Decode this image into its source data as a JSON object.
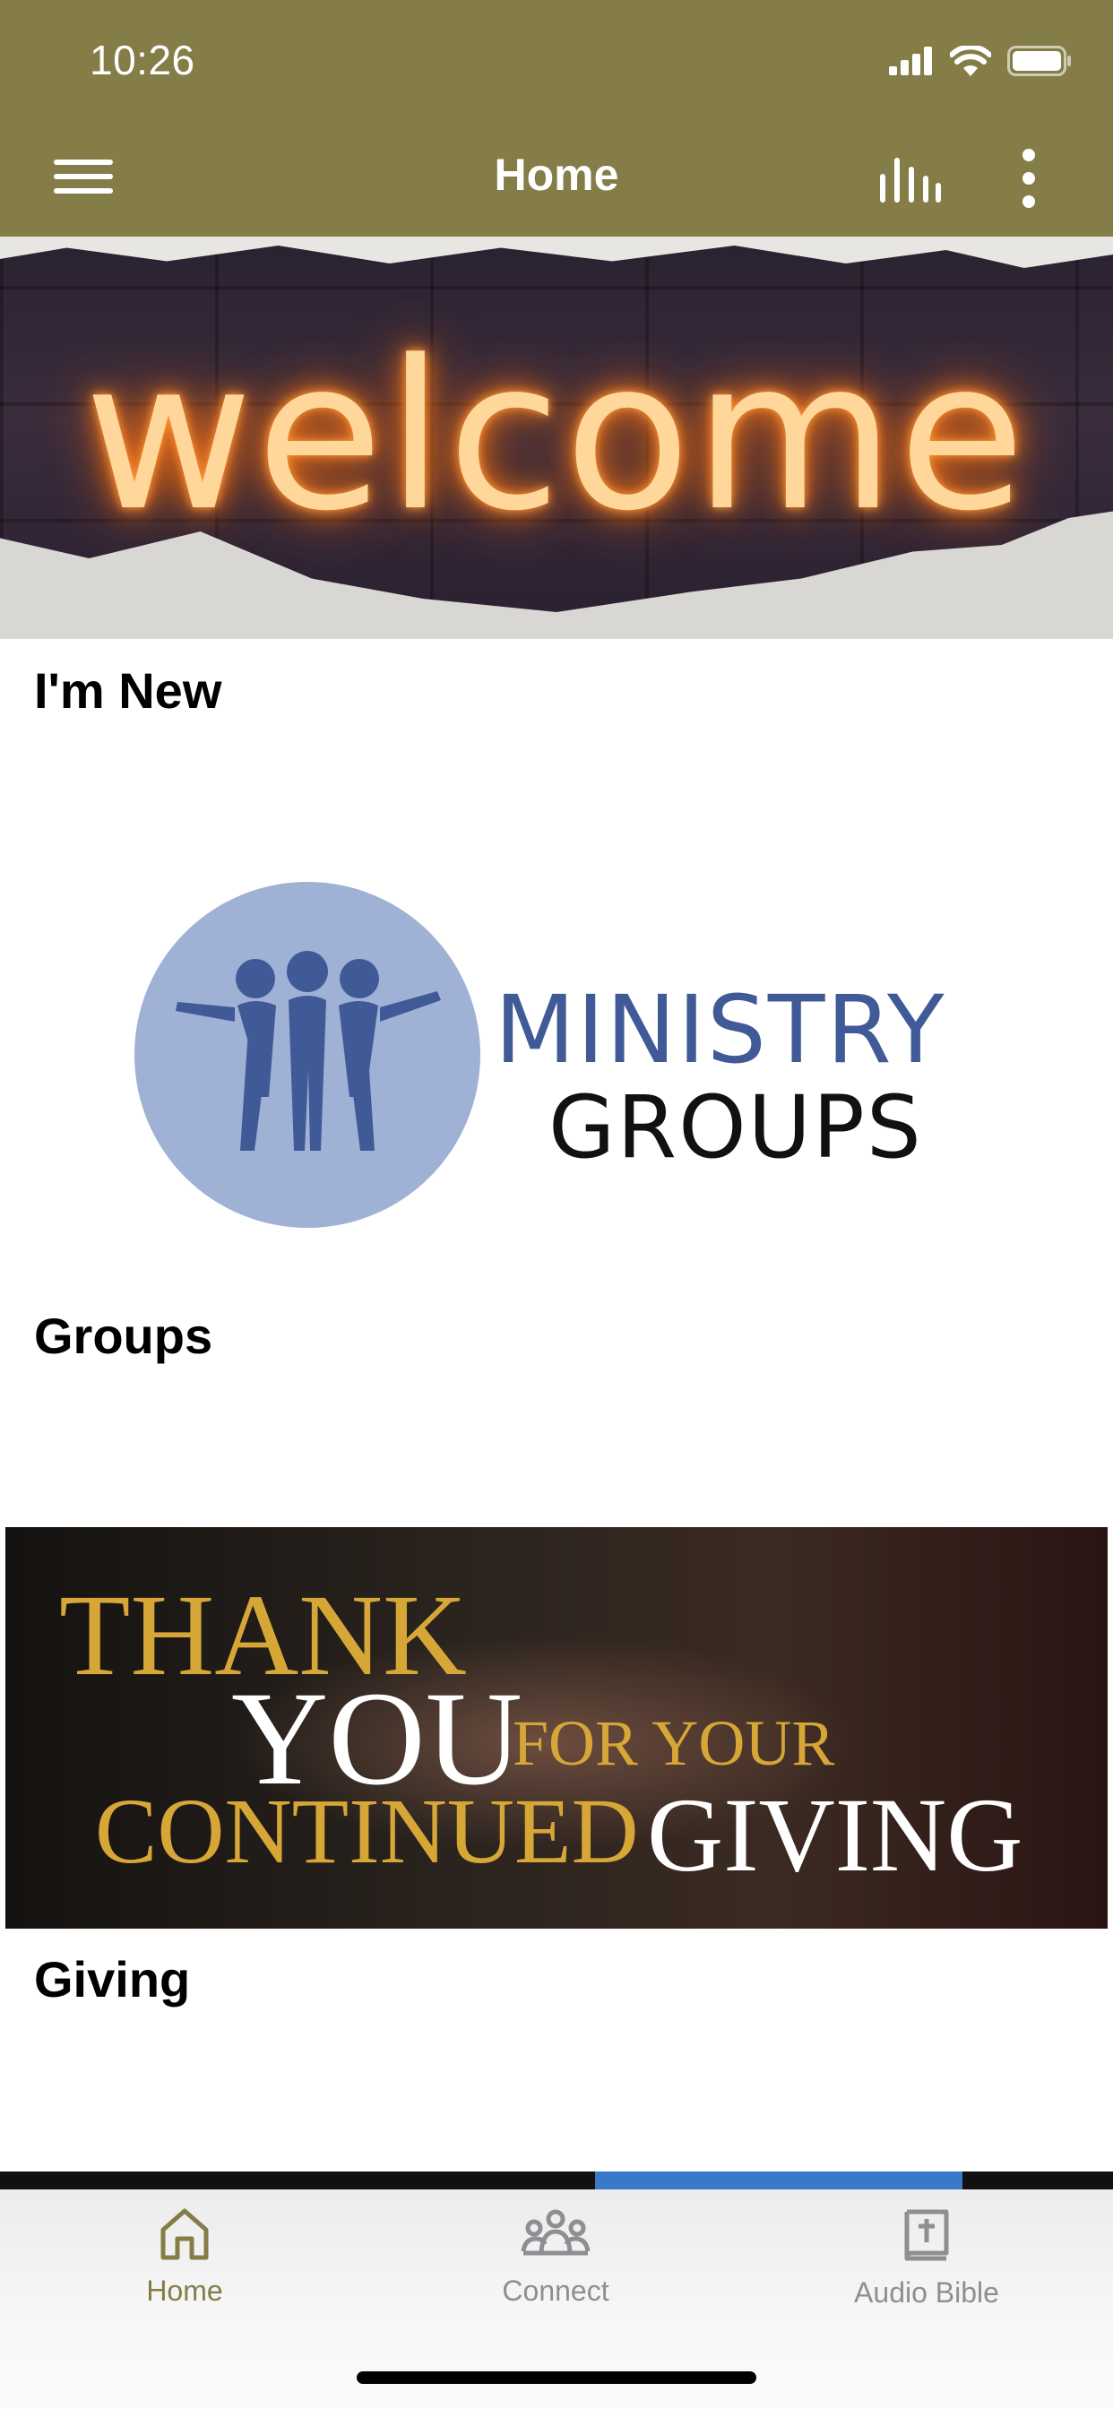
{
  "status_bar": {
    "time": "10:26"
  },
  "header": {
    "title": "Home"
  },
  "colors": {
    "accent": "#857d47",
    "tab_inactive": "#8e8e93",
    "background": "#ffffff"
  },
  "icons": {
    "menu": "hamburger-menu-icon",
    "audio": "audio-bars-icon",
    "more": "more-vertical-icon",
    "home": "home-icon",
    "connect": "people-group-icon",
    "audio_bible": "bible-book-icon"
  },
  "cards": [
    {
      "label": "I'm New",
      "image_text": "welcome"
    },
    {
      "label": "Groups",
      "image_text": {
        "title": "MINISTRY",
        "subtitle": "GROUPS"
      }
    },
    {
      "label": "Giving",
      "image_text": {
        "line1": "THANK",
        "line2": "YOU",
        "line3": "FOR YOUR",
        "line4": "CONTINUED",
        "line5": "GIVING"
      }
    }
  ],
  "tabs": [
    {
      "label": "Home",
      "active": true
    },
    {
      "label": "Connect",
      "active": false
    },
    {
      "label": "Audio Bible",
      "active": false
    }
  ]
}
